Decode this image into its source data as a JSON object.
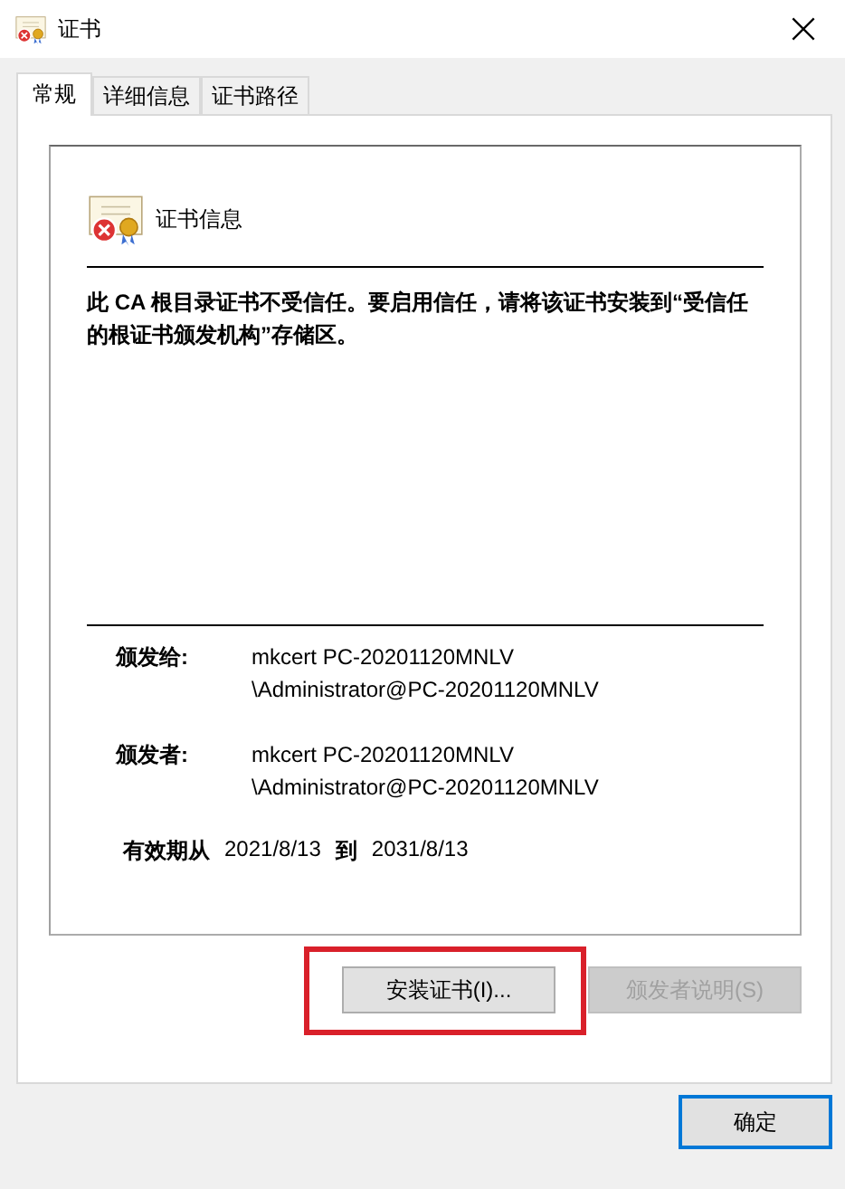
{
  "window": {
    "title": "证书"
  },
  "tabs": [
    {
      "label": "常规",
      "selected": true
    },
    {
      "label": "详细信息",
      "selected": false
    },
    {
      "label": "证书路径",
      "selected": false
    }
  ],
  "certificate": {
    "heading": "证书信息",
    "trusted": false,
    "message": "此 CA 根目录证书不受信任。要启用信任，请将该证书安装到“受信任的根证书颁发机构”存储区。",
    "fields": [
      {
        "label": "颁发给:",
        "value": "mkcert PC-20201120MNLV \\Administrator@PC-20201120MNLV"
      },
      {
        "label": "颁发者:",
        "value": "mkcert PC-20201120MNLV \\Administrator@PC-20201120MNLV"
      }
    ],
    "validity": {
      "from_label": "有效期从",
      "from": "2021/8/13",
      "to_label": "到",
      "to": "2031/8/13"
    }
  },
  "buttons": [
    {
      "label": "安装证书(I)...",
      "disabled": false,
      "highlighted": true
    },
    {
      "label": "颁发者说明(S)",
      "disabled": true,
      "highlighted": false
    }
  ],
  "footer_button": {
    "label": "确定",
    "focused": true
  }
}
